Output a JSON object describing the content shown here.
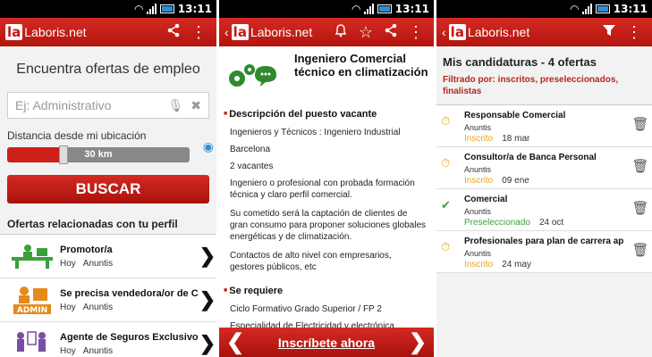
{
  "status": {
    "time": "13:11"
  },
  "app": {
    "name": "Laboris.net",
    "logo_mark": "la"
  },
  "search_screen": {
    "title": "Encuentra ofertas de empleo",
    "search_placeholder": "Ej: Administrativo",
    "distance_label": "Distancia desde mi ubicación",
    "distance_value": "30 km",
    "distance_km": 30,
    "search_button": "BUSCAR",
    "related_title": "Ofertas relacionadas con tu perfil",
    "related": [
      {
        "title": "Promotor/a",
        "when": "Hoy",
        "source": "Anuntis",
        "icon": "office-desk-icon"
      },
      {
        "title": "Se precisa vendedora/or de Co",
        "when": "Hoy",
        "source": "Anuntis",
        "icon": "admin-icon",
        "badge": "ADMIN"
      },
      {
        "title": "Agente de Seguros Exclusivo e",
        "when": "Hoy",
        "source": "Anuntis",
        "icon": "meeting-icon"
      }
    ]
  },
  "detail_screen": {
    "job_title": "Ingeniero Comercial técnico en climatización",
    "section_description": "Descripción del puesto vacante",
    "desc_lines": [
      "Ingenieros y Técnicos : Ingeniero Industrial",
      "Barcelona",
      "2 vacantes",
      "Ingeniero o profesional con probada formación técnica y claro perfil comercial.",
      "Su cometido será la captación de clientes de gran consumo para proponer soluciones globales energéticas y de climatización.",
      "Contactos de alto nivel con empresarios, gestores públicos, etc"
    ],
    "section_requirements": "Se requiere",
    "req_lines": [
      "Ciclo Formativo Grado Superior / FP 2",
      "Especialidad de Electricidad y electrónica"
    ],
    "apply_button": "Inscríbete ahora"
  },
  "candidatures_screen": {
    "title": "Mis candidaturas - 4 ofertas",
    "filter": "Filtrado por: inscritos, preseleccionados, finalistas",
    "items": [
      {
        "title": "Responsable Comercial",
        "company": "Anuntis",
        "status": "Inscrito",
        "status_color": "#e5a71a",
        "date": "18 mar"
      },
      {
        "title": "Consultor/a de Banca Personal",
        "company": "Anuntis",
        "status": "Inscrito",
        "status_color": "#e5a71a",
        "date": "09 ene"
      },
      {
        "title": "Comercial",
        "company": "Anuntis",
        "status": "Preseleccionado",
        "status_color": "#3aa13a",
        "date": "24 oct"
      },
      {
        "title": "Profesionales para plan de carrera ap",
        "company": "Anuntis",
        "status": "Inscrito",
        "status_color": "#e5a71a",
        "date": "24 may"
      }
    ]
  },
  "colors": {
    "brand_red": "#c21a14",
    "inscrito": "#e5a71a",
    "preseleccionado": "#3aa13a"
  }
}
